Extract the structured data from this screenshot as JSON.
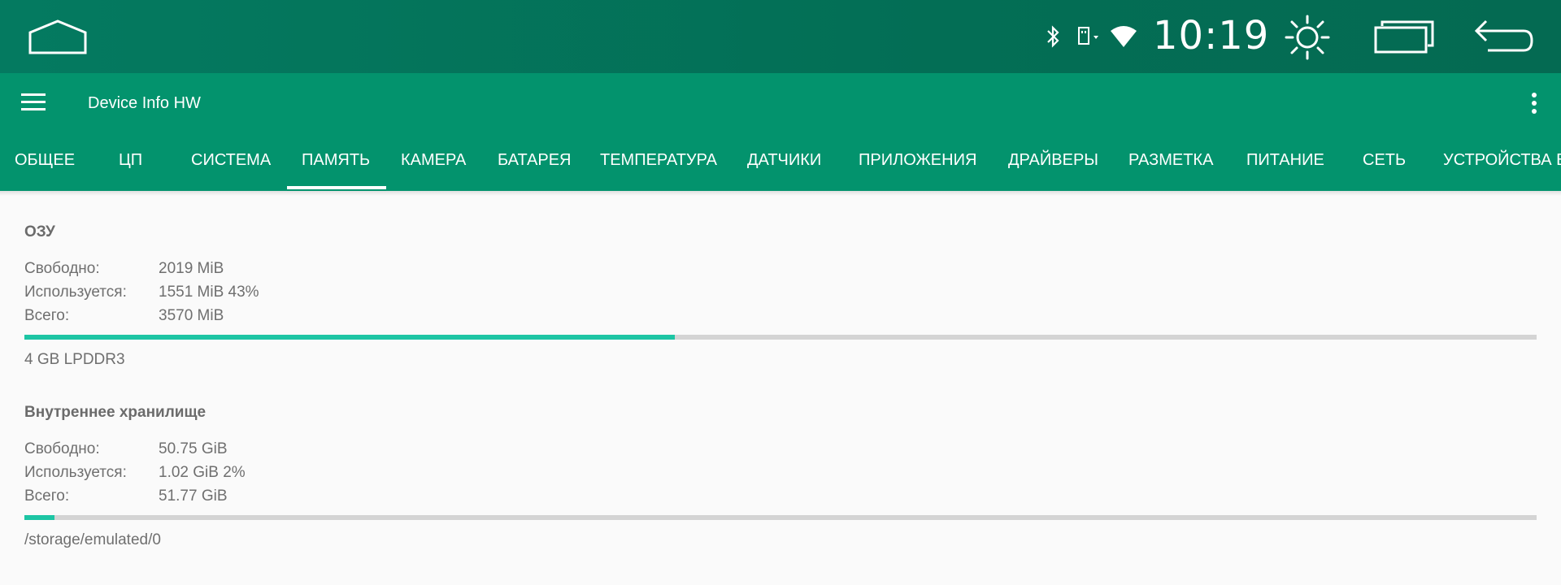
{
  "status_bar": {
    "time": "10:19",
    "icons": [
      "home-icon",
      "bluetooth-icon",
      "usb-icon",
      "wifi-icon",
      "brightness-icon",
      "recent-apps-icon",
      "back-icon"
    ]
  },
  "app_bar": {
    "title": "Device Info HW",
    "menu_icon": "hamburger-menu-icon",
    "overflow_icon": "more-vert-icon"
  },
  "tabs": [
    {
      "label": "ОБЩЕЕ"
    },
    {
      "label": "ЦП"
    },
    {
      "label": "СИСТЕМА"
    },
    {
      "label": "ПАМЯТЬ",
      "active": true
    },
    {
      "label": "КАМЕРА"
    },
    {
      "label": "БАТАРЕЯ"
    },
    {
      "label": "ТЕМПЕРАТУРА"
    },
    {
      "label": "ДАТЧИКИ"
    },
    {
      "label": "ПРИЛОЖЕНИЯ"
    },
    {
      "label": "ДРАЙВЕРЫ"
    },
    {
      "label": "РАЗМЕТКА"
    },
    {
      "label": "ПИТАНИЕ"
    },
    {
      "label": "СЕТЬ"
    },
    {
      "label": "УСТРОЙСТВА В"
    }
  ],
  "ram": {
    "title": "ОЗУ",
    "rows": [
      {
        "label": "Свободно:",
        "value": "2019 MiB"
      },
      {
        "label": "Используется:",
        "value": "1551 MiB 43%"
      },
      {
        "label": "Всего:",
        "value": "3570 MiB"
      }
    ],
    "usage_fraction": 0.43,
    "footnote": "4 GB LPDDR3"
  },
  "storage": {
    "title": "Внутреннее хранилище",
    "rows": [
      {
        "label": "Свободно:",
        "value": "50.75 GiB"
      },
      {
        "label": "Используется:",
        "value": "1.02 GiB 2%"
      },
      {
        "label": "Всего:",
        "value": "51.77 GiB"
      }
    ],
    "usage_fraction": 0.02,
    "footnote": "/storage/emulated/0"
  },
  "colors": {
    "status_bar": "#047a60",
    "app_bar": "#03936d",
    "accent": "#1dc5a4",
    "track": "#d4d4d4",
    "text": "#6f6f6f"
  }
}
